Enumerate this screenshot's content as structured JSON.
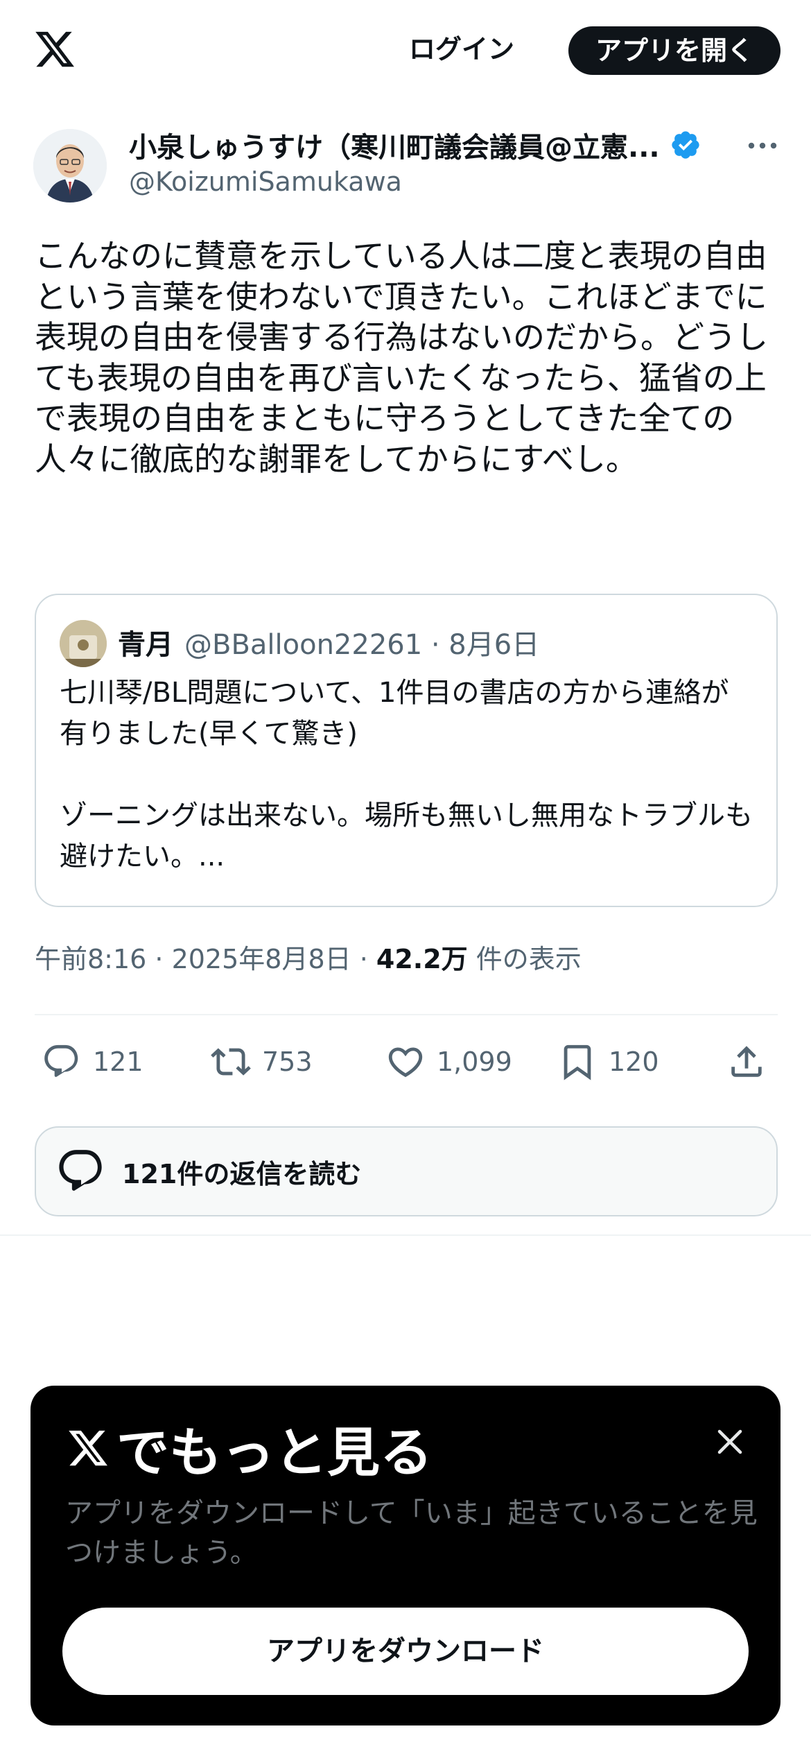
{
  "header": {
    "login_label": "ログイン",
    "open_app_label": "アプリを開く"
  },
  "author": {
    "display_name": "小泉しゅうすけ（寒川町議会議員@立憲...",
    "handle": "@KoizumiSamukawa",
    "verified_color": "#1d9bf0"
  },
  "tweet": {
    "text": "こんなのに賛意を示している人は二度と表現の自由という言葉を使わないで頂きたい。これほどまでに表現の自由を侵害する行為はないのだから。どうしても表現の自由を再び言いたくなったら、猛省の上で表現の自由をまともに守ろうとしてきた全ての人々に徹底的な謝罪をしてからにすべし。"
  },
  "quote": {
    "name": "青月",
    "handle_date": "@BBalloon22261 · 8月6日",
    "body": "七川琴/BL問題について、1件目の書店の方から連絡が有りました(早くて驚き)\n\nゾーニングは出来ない。場所も無いし無用なトラブルも避けたい。..."
  },
  "meta": {
    "timestamp": "午前8:16 · 2025年8月8日 · ",
    "views": "42.2万",
    "views_label": " 件の表示"
  },
  "actions": {
    "replies": "121",
    "reposts": "753",
    "likes": "1,099",
    "bookmarks": "120"
  },
  "read_replies_label": "121件の返信を読む",
  "promo": {
    "title": "でもっと見る",
    "description": "アプリをダウンロードして「いま」起きていることを見つけましょう。",
    "button_label": "アプリをダウンロード"
  },
  "icons": [
    "x-logo-icon",
    "verified-badge-icon",
    "more-icon",
    "reply-icon",
    "repost-icon",
    "like-icon",
    "bookmark-icon",
    "share-icon",
    "speech-bubbles-icon",
    "close-icon"
  ]
}
